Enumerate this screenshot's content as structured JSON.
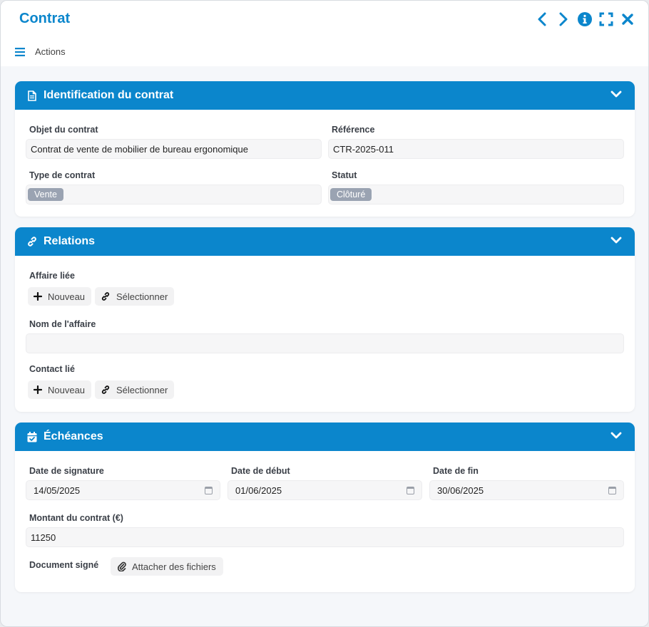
{
  "window": {
    "title": "Contrat",
    "actions_label": "Actions"
  },
  "identification": {
    "title": "Identification du contrat",
    "objet_label": "Objet du contrat",
    "objet_value": "Contrat de vente de mobilier de bureau ergonomique",
    "reference_label": "Référence",
    "reference_value": "CTR-2025-011",
    "type_label": "Type de contrat",
    "type_value": "Vente",
    "statut_label": "Statut",
    "statut_value": "Clôturé"
  },
  "relations": {
    "title": "Relations",
    "affaire_label": "Affaire liée",
    "nom_affaire_label": "Nom de l'affaire",
    "nom_affaire_value": "",
    "contact_label": "Contact lié",
    "nouveau_label": "Nouveau",
    "selectionner_label": "Sélectionner"
  },
  "echeances": {
    "title": "Échéances",
    "signature_label": "Date de signature",
    "signature_value": "14/05/2025",
    "debut_label": "Date de début",
    "debut_value": "01/06/2025",
    "fin_label": "Date de fin",
    "fin_value": "30/06/2025",
    "montant_label": "Montant du contrat (€)",
    "montant_value": "11250",
    "document_label": "Document signé",
    "attach_label": "Attacher des fichiers"
  },
  "colors": {
    "accent": "#0b86cc",
    "tag": "#9aa3b2"
  },
  "icons": [
    "chevron-left-icon",
    "chevron-right-icon",
    "info-icon",
    "fullscreen-icon",
    "close-icon",
    "menu-icon",
    "document-icon",
    "link-icon",
    "calendar-check-icon",
    "chevron-down-icon",
    "plus-icon",
    "paperclip-icon",
    "calendar-icon"
  ]
}
